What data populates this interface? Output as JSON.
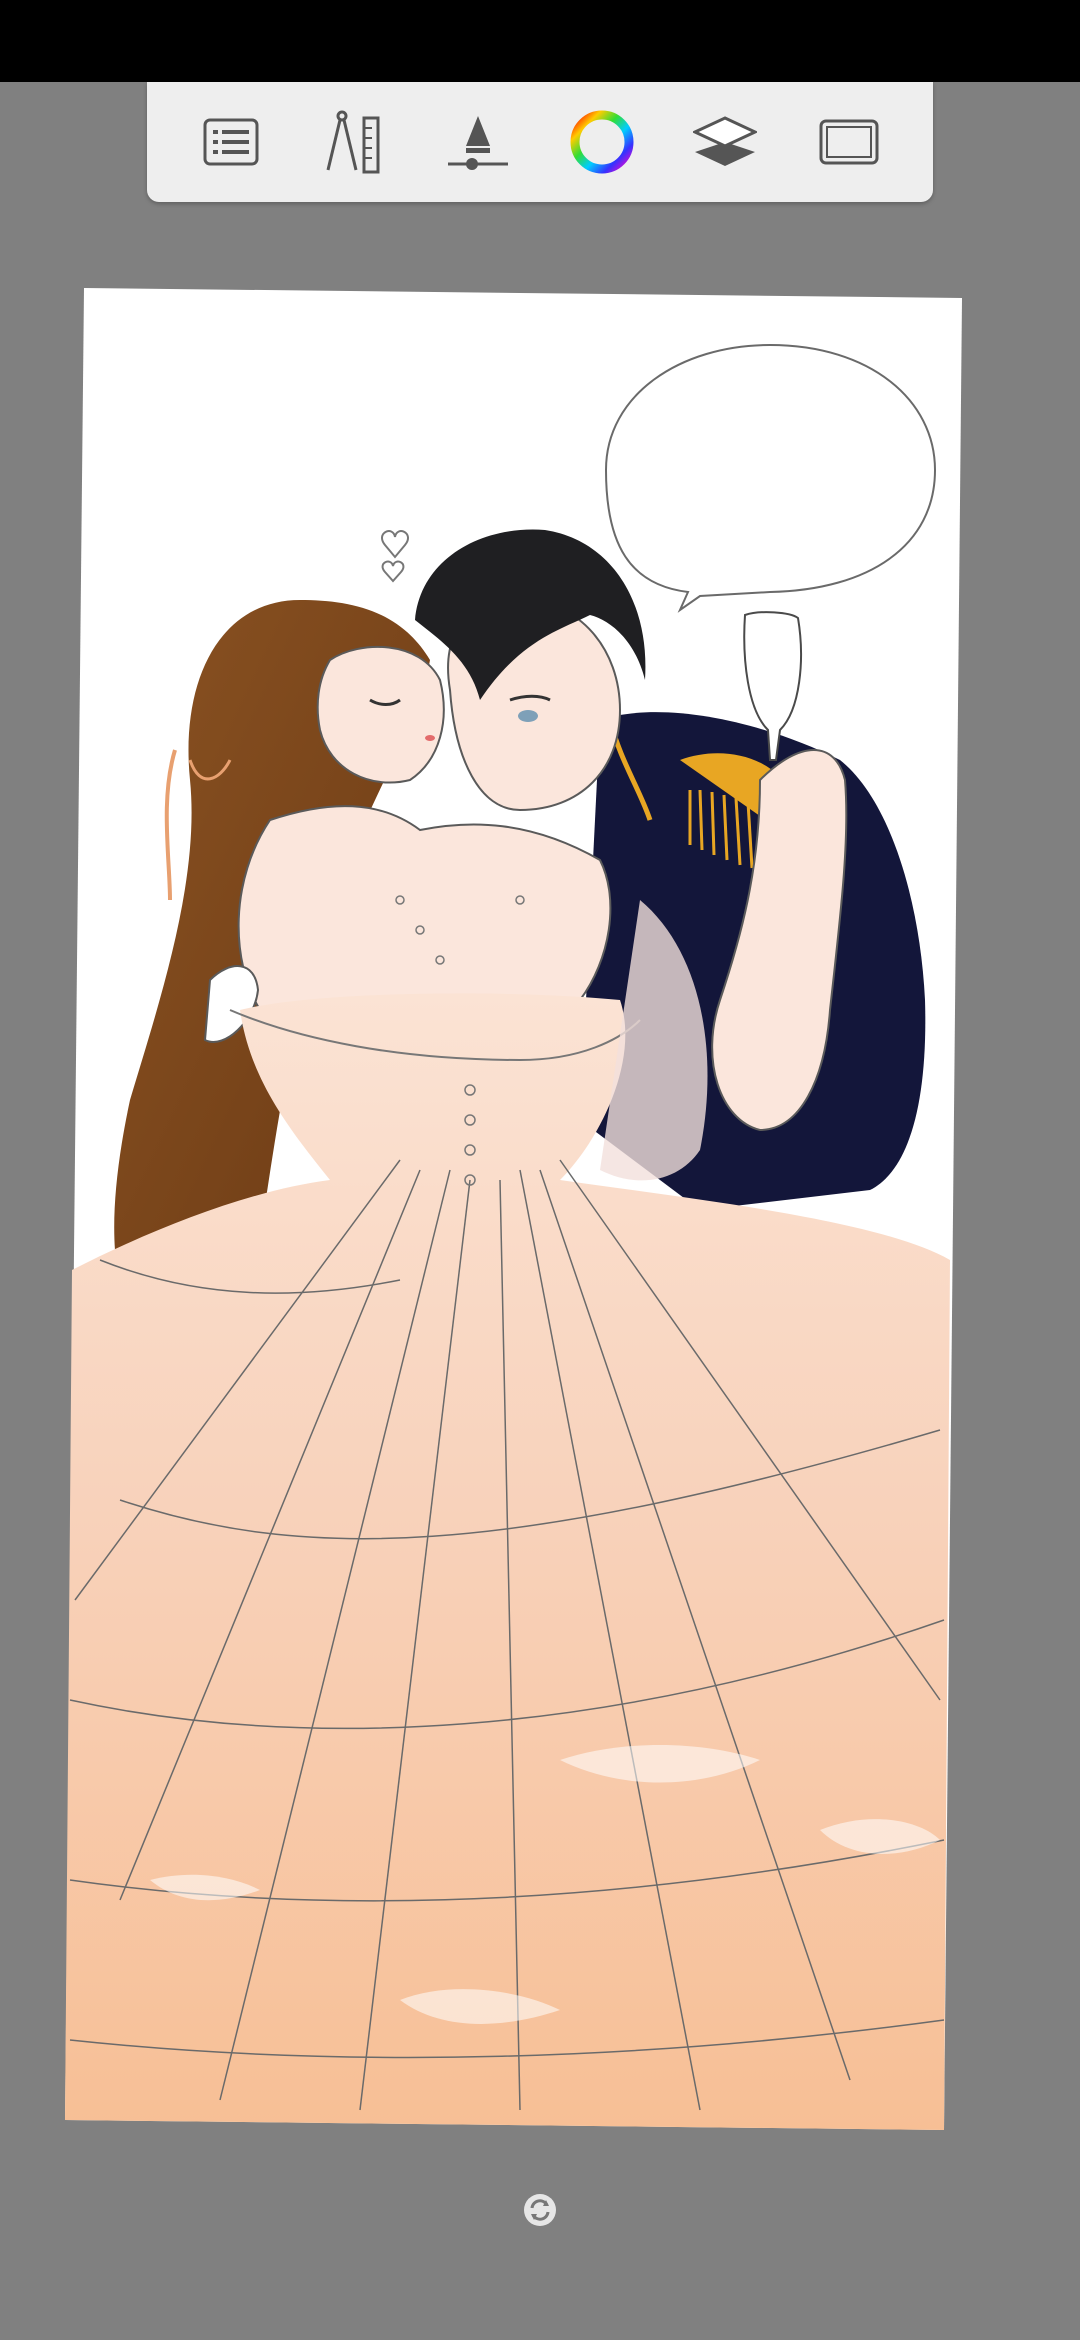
{
  "app": {
    "accent_colors": {
      "canvas_background": "#808080",
      "toolbar_background": "#eeeeee",
      "icon_color": "#555555"
    }
  },
  "toolbar": {
    "tools": [
      {
        "id": "menu",
        "icon": "list-icon"
      },
      {
        "id": "guides",
        "icon": "compass-ruler-icon"
      },
      {
        "id": "brush",
        "icon": "brush-size-icon"
      },
      {
        "id": "color",
        "icon": "color-wheel-icon"
      },
      {
        "id": "layers",
        "icon": "layers-icon"
      },
      {
        "id": "fullscreen",
        "icon": "fullscreen-icon"
      }
    ]
  },
  "canvas": {
    "artwork": "illustration-couple-ballgown",
    "palette": {
      "paper": "#ffffff",
      "dress_peach": "#f9c9a3",
      "dress_light": "#fbe3d4",
      "hair_brown": "#7a4419",
      "hair_black": "#1f1f22",
      "uniform_navy": "#13163a",
      "epaulette_gold": "#e8a623",
      "skin": "#fbe6dc",
      "line": "#4a4a4a"
    }
  },
  "bottom": {
    "sync_icon": "rotate-icon"
  }
}
